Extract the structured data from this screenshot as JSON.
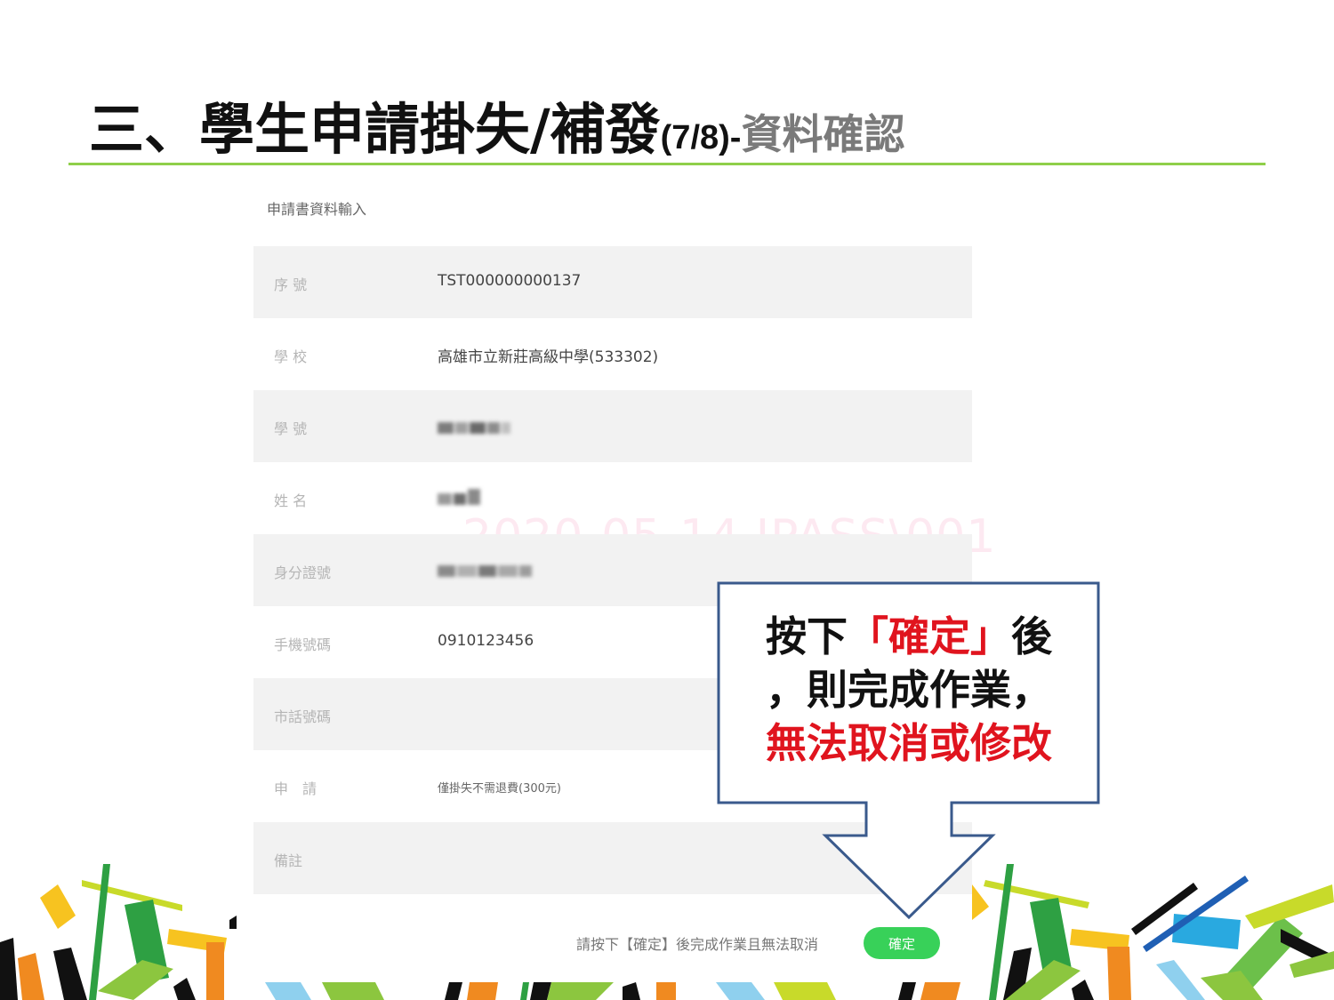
{
  "slide": {
    "title_main": "三、學生申請掛失/補發",
    "title_page": "(7/8)",
    "title_dash": "-",
    "title_sub": "資料確認"
  },
  "form": {
    "title": "申請書資料輸入",
    "rows": [
      {
        "label": "序 號",
        "value": "TST000000000137"
      },
      {
        "label": "學 校",
        "value": "高雄市立新莊高級中學(533302)"
      },
      {
        "label": "學 號",
        "value": ""
      },
      {
        "label": "姓 名",
        "value": ""
      },
      {
        "label": "身分證號",
        "value": ""
      },
      {
        "label": "手機號碼",
        "value": "0910123456"
      },
      {
        "label": "市話號碼",
        "value": ""
      },
      {
        "label": "申　請",
        "value": "僅掛失不需退費(300元)"
      },
      {
        "label": "備註",
        "value": ""
      }
    ],
    "watermark": "2020-05-14  IPASS\\001",
    "confirm_hint": "請按下【確定】後完成作業且無法取消",
    "confirm_button": "確定"
  },
  "callout": {
    "line1_a": "按下",
    "line1_b": "「確定」",
    "line1_c": "後",
    "line2": "，則完成作業，",
    "line3": "無法取消或修改"
  },
  "colors": {
    "accent_green": "#8fcf4a",
    "button_green": "#38d159",
    "callout_border": "#3a5a8c",
    "highlight_red": "#e0141e"
  }
}
